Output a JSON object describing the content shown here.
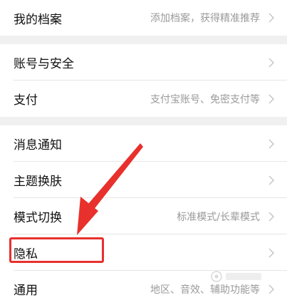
{
  "settings": {
    "rows": [
      {
        "label": "我的档案",
        "value": "添加档案，获得精准推荐"
      },
      {
        "label": "账号与安全",
        "value": ""
      },
      {
        "label": "支付",
        "value": "支付宝账号、免密支付等"
      },
      {
        "label": "消息通知",
        "value": ""
      },
      {
        "label": "主题换肤",
        "value": ""
      },
      {
        "label": "模式切换",
        "value": "标准模式/长辈模式"
      },
      {
        "label": "隐私",
        "value": ""
      },
      {
        "label": "通用",
        "value": "地区、音效、辅助功能等"
      }
    ]
  },
  "colors": {
    "annotation": "#e8302c",
    "background": "#f0f0f0",
    "secondary_text": "#9a9a9a"
  },
  "icons": {
    "row_chevron": "chevron-right-icon"
  }
}
